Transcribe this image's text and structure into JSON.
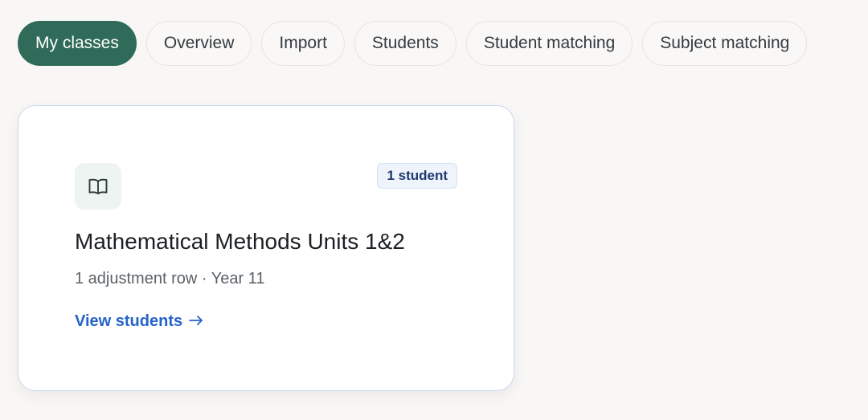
{
  "tabs": [
    {
      "label": "My classes",
      "active": true
    },
    {
      "label": "Overview",
      "active": false
    },
    {
      "label": "Import",
      "active": false
    },
    {
      "label": "Students",
      "active": false
    },
    {
      "label": "Student matching",
      "active": false
    },
    {
      "label": "Subject matching",
      "active": false
    }
  ],
  "class_card": {
    "icon": "book-icon",
    "badge": "1 student",
    "title": "Mathematical Methods Units 1&2",
    "meta": "1 adjustment row · Year 11",
    "link_label": "View students",
    "link_icon": "arrow-right-icon"
  },
  "colors": {
    "accent": "#2f6b58",
    "link": "#2563c9",
    "badge_text": "#1e3a6e"
  }
}
